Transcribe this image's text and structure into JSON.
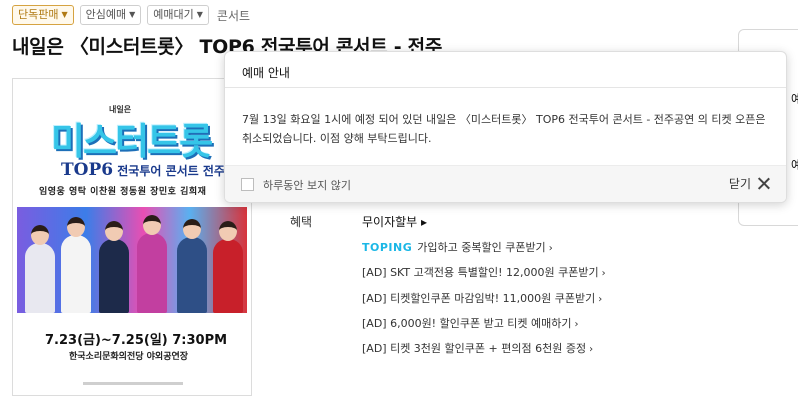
{
  "tags": [
    {
      "label": "단독판매",
      "style": "primary"
    },
    {
      "label": "안심예매",
      "style": "normal"
    },
    {
      "label": "예매대기",
      "style": "normal"
    }
  ],
  "breadcrumb_text": "콘서트",
  "page_title": "내일은 〈미스터트롯〉 TOP6 전국투어 콘서트 - 전주",
  "poster": {
    "small_text": "내일은",
    "logo": "미스터트롯",
    "subtitle_big": "TOP6",
    "subtitle_rest": " 전국투어 콘서트 전주",
    "names": "임영웅 영탁 이찬원 정동원 장민호 김희재",
    "date": "7.23(금)~7.25(일) 7:30PM",
    "venue": "한국소리문화의전당 야외공연장"
  },
  "benefit": {
    "label": "혜택",
    "main": "무이자할부 ▸",
    "toping_logo": "TOPING",
    "promos": [
      {
        "text": "가입하고 중복할인 쿠폰받기",
        "chev": "›"
      },
      {
        "text": "[AD] SKT 고객전용 특별할인! 12,000원 쿠폰받기",
        "chev": "›"
      },
      {
        "text": "[AD] 티켓할인쿠폰 마감임박! 11,000원 쿠폰받기",
        "chev": "›"
      },
      {
        "text": "[AD] 6,000원! 할인쿠폰 받고 티켓 예매하기",
        "chev": "›"
      },
      {
        "text": "[AD] 티켓 3천원 할인쿠폰 + 편의점 6천원 증정",
        "chev": "›"
      }
    ]
  },
  "side_box": {
    "peek1": "예",
    "peek2": "예"
  },
  "modal": {
    "title": "예매 안내",
    "body": "7월 13일 화요일 1시에 예정 되어 있던 내일은 〈미스터트롯〉 TOP6 전국투어 콘서트 - 전주공연 의 티켓 오픈은 취소되었습니다. 이점 양해 부탁드립니다.",
    "checkbox_label": "하루동안 보지 않기",
    "checkbox_checked": false,
    "close_label": "닫기"
  },
  "colors": {
    "primary_tag_border": "#d6a341",
    "primary_tag_text": "#b07a14",
    "toping": "#1bb7e6"
  }
}
